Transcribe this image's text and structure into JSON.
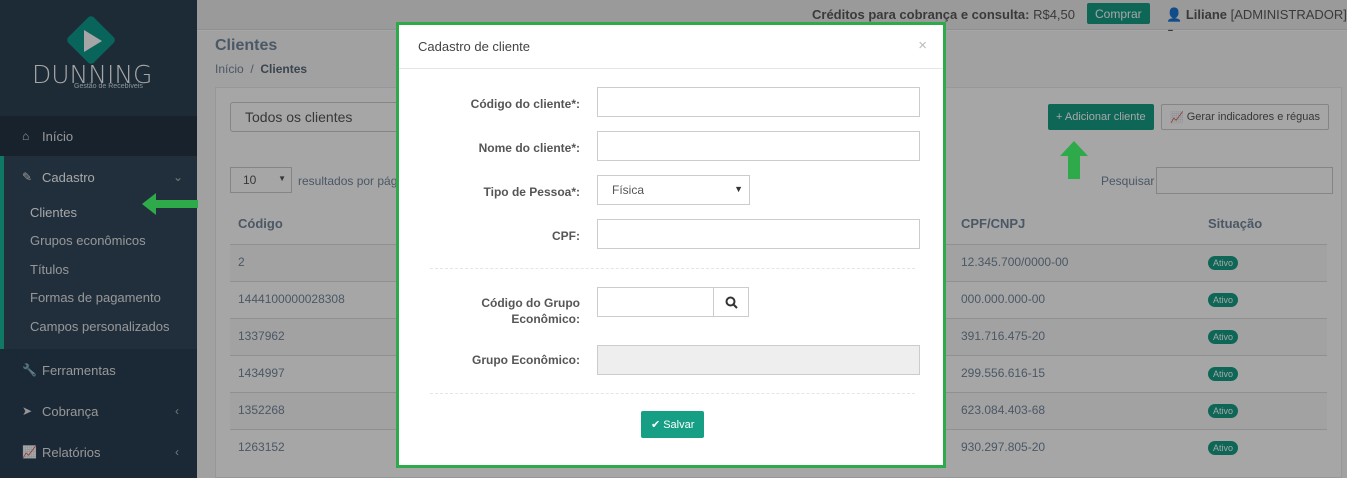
{
  "brand": {
    "name": "DUNNING",
    "tagline": "Gestão de Recebíveis"
  },
  "sidebar": {
    "inicio": "Início",
    "cadastro": "Cadastro",
    "cadastro_items": [
      "Clientes",
      "Grupos econômicos",
      "Títulos",
      "Formas de pagamento",
      "Campos personalizados"
    ],
    "ferramentas": "Ferramentas",
    "cobranca": "Cobrança",
    "relatorios": "Relatórios"
  },
  "topbar": {
    "credits_label": "Créditos para cobrança e consulta:",
    "credits_value": "R$4,50",
    "buy_label": "Comprar",
    "user_name": "Liliane",
    "user_role": "[ADMINISTRADOR]"
  },
  "page": {
    "title": "Clientes",
    "breadcrumb_home": "Início",
    "breadcrumb_current": "Clientes",
    "filter_value": "Todos os clientes",
    "add_button": "+ Adicionar cliente",
    "indicators_button": "Gerar indicadores e réguas",
    "page_size": "10",
    "results_label": "resultados por página",
    "search_label": "Pesquisar"
  },
  "table": {
    "headers": {
      "codigo": "Código",
      "cpf": "CPF/CNPJ",
      "situacao": "Situação"
    },
    "rows": [
      {
        "codigo": "2",
        "cpf": "12.345.700/0000-00",
        "situacao": "Ativo"
      },
      {
        "codigo": "1444100000028308",
        "cpf": "000.000.000-00",
        "situacao": "Ativo"
      },
      {
        "codigo": "1337962",
        "cpf": "391.716.475-20",
        "situacao": "Ativo"
      },
      {
        "codigo": "1434997",
        "cpf": "299.556.616-15",
        "situacao": "Ativo"
      },
      {
        "codigo": "1352268",
        "cpf": "623.084.403-68",
        "situacao": "Ativo"
      },
      {
        "codigo": "1263152",
        "cpf": "930.297.805-20",
        "situacao": "Ativo"
      }
    ]
  },
  "modal": {
    "title": "Cadastro de cliente",
    "close": "×",
    "codigo_label": "Código do cliente*:",
    "nome_label": "Nome do cliente*:",
    "tipo_label": "Tipo de Pessoa*:",
    "tipo_value": "Física",
    "cpf_label": "CPF:",
    "grupo_codigo_label_1": "Código do Grupo",
    "grupo_codigo_label_2": "Econômico:",
    "grupo_label": "Grupo Econômico:",
    "save_label": "Salvar"
  },
  "colors": {
    "accent": "#169f85",
    "sidebar": "#2a3f54",
    "highlight_border": "#2eaa4a"
  }
}
